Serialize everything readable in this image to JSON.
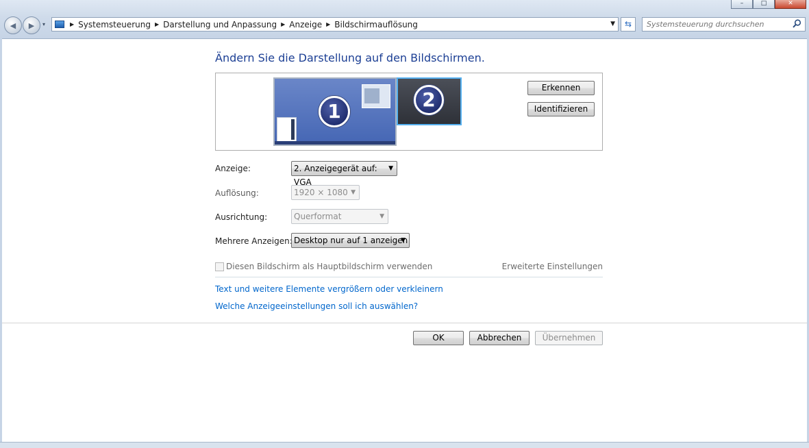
{
  "window": {
    "caption_buttons": [
      "–",
      "□",
      "✕"
    ]
  },
  "nav": {
    "back_glyph": "◀",
    "forward_glyph": "▶",
    "dropdown_glyph": "▾"
  },
  "breadcrumb": {
    "items": [
      "Systemsteuerung",
      "Darstellung und Anpassung",
      "Anzeige",
      "Bildschirmauflösung"
    ],
    "separator": "▶",
    "dropdown_glyph": "▼"
  },
  "refresh_glyph": "⇆",
  "search": {
    "placeholder": "Systemsteuerung durchsuchen",
    "icon": "search-icon"
  },
  "main": {
    "title": "Ändern Sie die Darstellung auf den Bildschirmen.",
    "monitors": [
      {
        "number": "1",
        "selected": false
      },
      {
        "number": "2",
        "selected": true
      }
    ],
    "detect_button": "Erkennen",
    "identify_button": "Identifizieren",
    "display_label": "Anzeige:",
    "display_value": "2. Anzeigegerät auf: VGA",
    "resolution_label": "Auflösung:",
    "resolution_value": "1920 × 1080",
    "orientation_label": "Ausrichtung:",
    "orientation_value": "Querformat",
    "multiple_label": "Mehrere Anzeigen:",
    "multiple_value": "Desktop nur auf 1 anzeigen",
    "dropdown_arrow": "▼",
    "main_display_checkbox_label": "Diesen Bildschirm als Hauptbildschirm verwenden",
    "main_display_checked": false,
    "advanced_settings_link": "Erweiterte Einstellungen",
    "text_size_link": "Text und weitere Elemente vergrößern oder verkleinern",
    "help_link": "Welche Anzeigeeinstellungen soll ich auswählen?"
  },
  "footer": {
    "ok_button": "OK",
    "cancel_button": "Abbrechen",
    "apply_button": "Übernehmen"
  },
  "colors": {
    "title": "#1c3f94",
    "link": "#0066cc",
    "selected_monitor_border": "#55b0f0"
  }
}
